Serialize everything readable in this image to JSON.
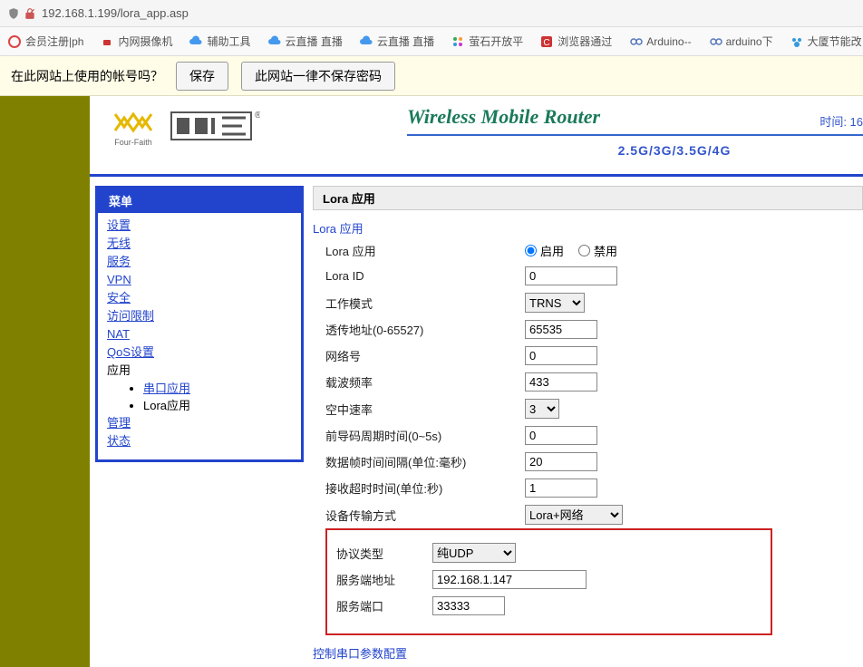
{
  "browser": {
    "url": "192.168.1.199/lora_app.asp"
  },
  "bookmarks": [
    {
      "label": "会员注册|ph",
      "color": "#d44"
    },
    {
      "label": "内网摄像机",
      "color": "#c33"
    },
    {
      "label": "辅助工具",
      "color": "#3399dd"
    },
    {
      "label": "云直播 直播",
      "color": "#3399dd"
    },
    {
      "label": "云直播 直播",
      "color": "#3399dd"
    },
    {
      "label": "萤石开放平",
      "color": "#multi"
    },
    {
      "label": "浏览器通过",
      "color": "#c33"
    },
    {
      "label": "Arduino--",
      "color": "#5577bb"
    },
    {
      "label": "arduino下",
      "color": "#5577bb"
    },
    {
      "label": "大厦节能改",
      "color": "#3399dd"
    }
  ],
  "save_prompt": {
    "question": "在此网站上使用的帐号吗？",
    "save": "保存",
    "never": "此网站一律不保存密码"
  },
  "header": {
    "brand_sub": "Four-Faith",
    "title": "Wireless Mobile Router",
    "bands": "2.5G/3G/3.5G/4G",
    "time": "时间: 16"
  },
  "menu": {
    "title": "菜单",
    "items": [
      "设置",
      "无线",
      "服务",
      "VPN",
      "安全",
      "访问限制",
      "NAT",
      "QoS设置"
    ],
    "app_label": "应用",
    "sub": [
      {
        "label": "串口应用",
        "link": true
      },
      {
        "label": "Lora应用",
        "link": false
      }
    ],
    "tail": [
      "管理",
      "状态"
    ]
  },
  "panel": {
    "title": "Lora 应用",
    "section1": "Lora 应用",
    "fields": {
      "app_label": "Lora 应用",
      "enable": "启用",
      "disable": "禁用",
      "lora_id_label": "Lora ID",
      "lora_id": "0",
      "mode_label": "工作模式",
      "mode": "TRNS",
      "addr_label": "透传地址(0-65527)",
      "addr": "65535",
      "net_label": "网络号",
      "net": "0",
      "freq_label": "载波频率",
      "freq": "433",
      "rate_label": "空中速率",
      "rate": "3",
      "preamble_label": "前导码周期时间(0~5s)",
      "preamble": "0",
      "frame_label": "数据帧时间间隔(单位:毫秒)",
      "frame": "20",
      "timeout_label": "接收超时时间(单位:秒)",
      "timeout": "1",
      "transport_label": "设备传输方式",
      "transport": "Lora+网络",
      "proto_label": "协议类型",
      "proto": "纯UDP",
      "server_addr_label": "服务端地址",
      "server_addr": "192.168.1.147",
      "server_port_label": "服务端口",
      "server_port": "33333"
    },
    "section2": "控制串口参数配置"
  }
}
